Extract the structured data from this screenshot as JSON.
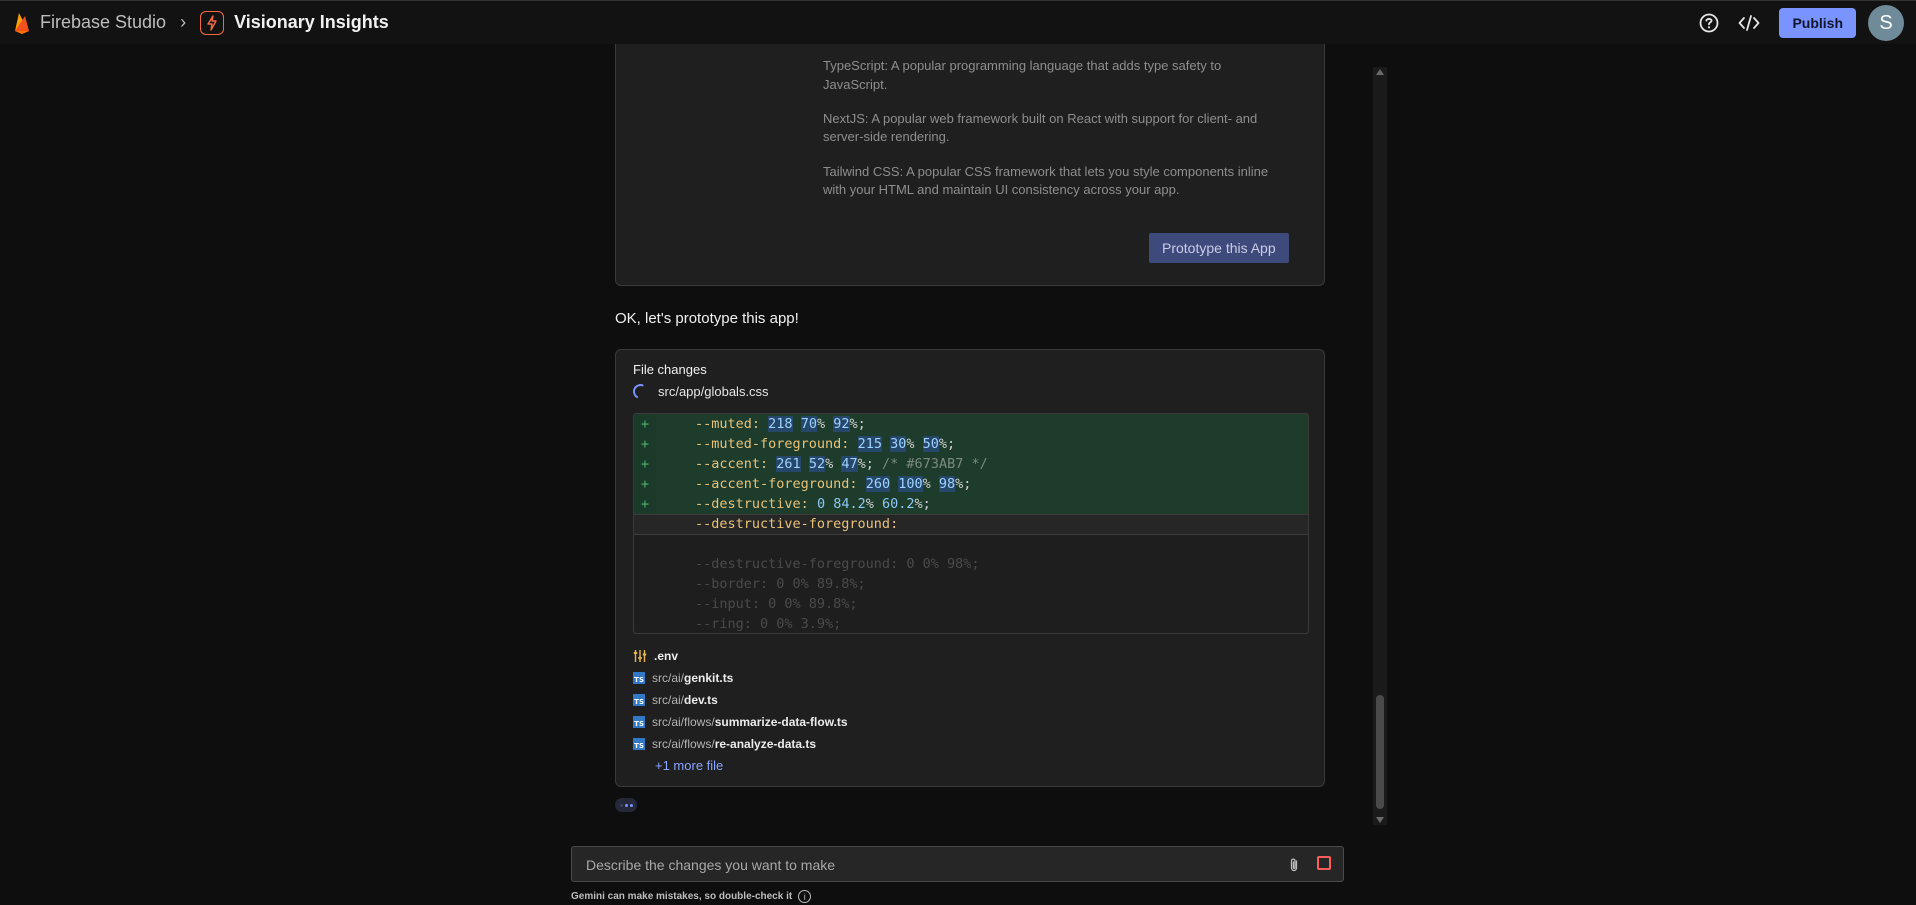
{
  "header": {
    "app_name": "Firebase Studio",
    "project_name": "Visionary Insights",
    "publish_label": "Publish",
    "avatar_initial": "S",
    "help_icon": "help-icon",
    "code_icon": "code-icon"
  },
  "stack_card": {
    "partial_line": "TypeScript: A popular programming language that adds type safety to",
    "items": [
      "JavaScript.",
      "NextJS: A popular web framework built on React with support for client- and server-side rendering.",
      "Tailwind CSS: A popular CSS framework that lets you style components inline with your HTML and maintain UI consistency across your app."
    ],
    "button_label": "Prototype this App"
  },
  "assistant_message": "OK, let's prototype this app!",
  "file_changes": {
    "title": "File changes",
    "current_file": "src/app/globals.css",
    "code_lines": [
      {
        "sign": "+",
        "prop": "--muted:",
        "value": [
          [
            "218",
            "70",
            "92"
          ]
        ],
        "comment": ""
      },
      {
        "sign": "+",
        "prop": "--muted-foreground:",
        "value": [
          [
            "215",
            "30",
            "50"
          ]
        ],
        "comment": ""
      },
      {
        "sign": "+",
        "prop": "--accent:",
        "value": [
          [
            "261",
            "52",
            "47"
          ]
        ],
        "comment": "/* #673AB7 */"
      },
      {
        "sign": "+",
        "prop": "--accent-foreground:",
        "value": [
          [
            "260",
            "100",
            "98"
          ]
        ],
        "comment": ""
      },
      {
        "sign": "+",
        "prop": "--destructive:",
        "value": [
          [
            "0",
            "84.2",
            "60.2"
          ]
        ],
        "comment": ""
      }
    ],
    "current_line": "--destructive-foreground:",
    "ghost_lines": [
      "--destructive-foreground: 0 0% 98%;",
      "--border: 0 0% 89.8%;",
      "--input: 0 0% 89.8%;",
      "--ring: 0 0% 3.9%;"
    ],
    "files": [
      {
        "dir": "",
        "name": ".env",
        "type": "env"
      },
      {
        "dir": "src/ai/",
        "name": "genkit.ts",
        "type": "ts"
      },
      {
        "dir": "src/ai/",
        "name": "dev.ts",
        "type": "ts"
      },
      {
        "dir": "src/ai/flows/",
        "name": "summarize-data-flow.ts",
        "type": "ts"
      },
      {
        "dir": "src/ai/flows/",
        "name": "re-analyze-data.ts",
        "type": "ts"
      }
    ],
    "more_label": "+1 more file"
  },
  "prompt": {
    "placeholder": "Describe the changes you want to make",
    "value": "",
    "attach_icon": "paperclip-icon",
    "stop_icon": "stop-icon"
  },
  "disclaimer": "Gemini can make mistakes, so double-check it",
  "colors": {
    "accent": "#7a94ff",
    "publish_bg": "#7a94ff",
    "brand_orange": "#f26a3a",
    "stop_red": "#ff5c5c",
    "diff_added_bg": "#1d3c2c"
  }
}
